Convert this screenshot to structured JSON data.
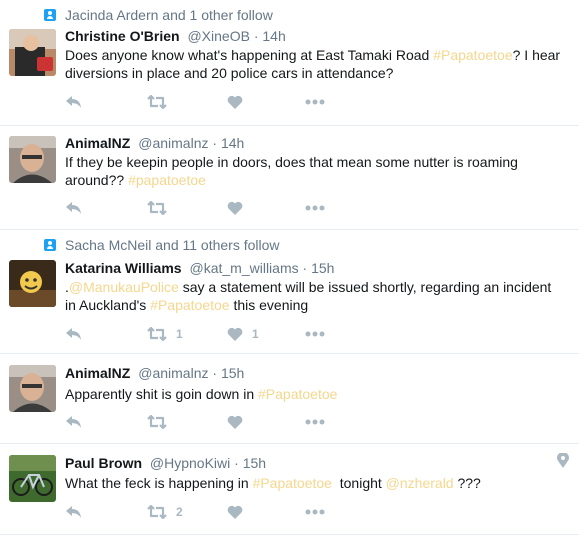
{
  "tweets": [
    {
      "context": "Jacinda Ardern and 1 other follow",
      "name": "Christine O'Brien",
      "handle": "@XineOB",
      "time": "14h",
      "text_a": "Does anyone know what's happening at East Tamaki Road ",
      "tag1": "#Papatoetoe",
      "text_b": "? I hear diversions in place and 20 police cars in attendance?",
      "retweets": "",
      "likes": ""
    },
    {
      "name": "AnimalNZ",
      "handle": "@animalnz",
      "time": "14h",
      "text_a": "If they be keepin people in doors, does that mean some nutter is roaming around?? ",
      "tag1": "#papatoetoe",
      "retweets": "",
      "likes": ""
    },
    {
      "context": "Sacha McNeil and 11 others follow",
      "name": "Katarina Williams",
      "handle": "@kat_m_williams",
      "time": "15h",
      "text_a": ".",
      "mention1": "@ManukauPolice",
      "text_b": " say a statement will be issued shortly, regarding an incident in Auckland's ",
      "tag1": "#Papatoetoe",
      "text_c": " this evening",
      "retweets": "1",
      "likes": "1"
    },
    {
      "name": "AnimalNZ",
      "handle": "@animalnz",
      "time": "15h",
      "text_a": "Apparently shit is goin down in ",
      "tag1": "#Papatoetoe",
      "retweets": "",
      "likes": ""
    },
    {
      "name": "Paul Brown",
      "handle": "@HypnoKiwi",
      "time": "15h",
      "text_a": "What the feck is happening in ",
      "tag1": "#Papatoetoe",
      "text_b": "  tonight ",
      "mention1": "@nzherald",
      "text_c": " ???",
      "retweets": "2",
      "likes": ""
    }
  ],
  "header_separator": "·",
  "colors": {
    "highlight": "#f5d78e",
    "follow_badge": "#1da1f2",
    "meta_text": "#657786",
    "action_icon": "#aab8c2",
    "divider": "#e6ecf0"
  },
  "icons": [
    "person-follow-icon",
    "reply-icon",
    "retweet-icon",
    "heart-icon",
    "more-dots-icon",
    "location-pin-icon"
  ]
}
